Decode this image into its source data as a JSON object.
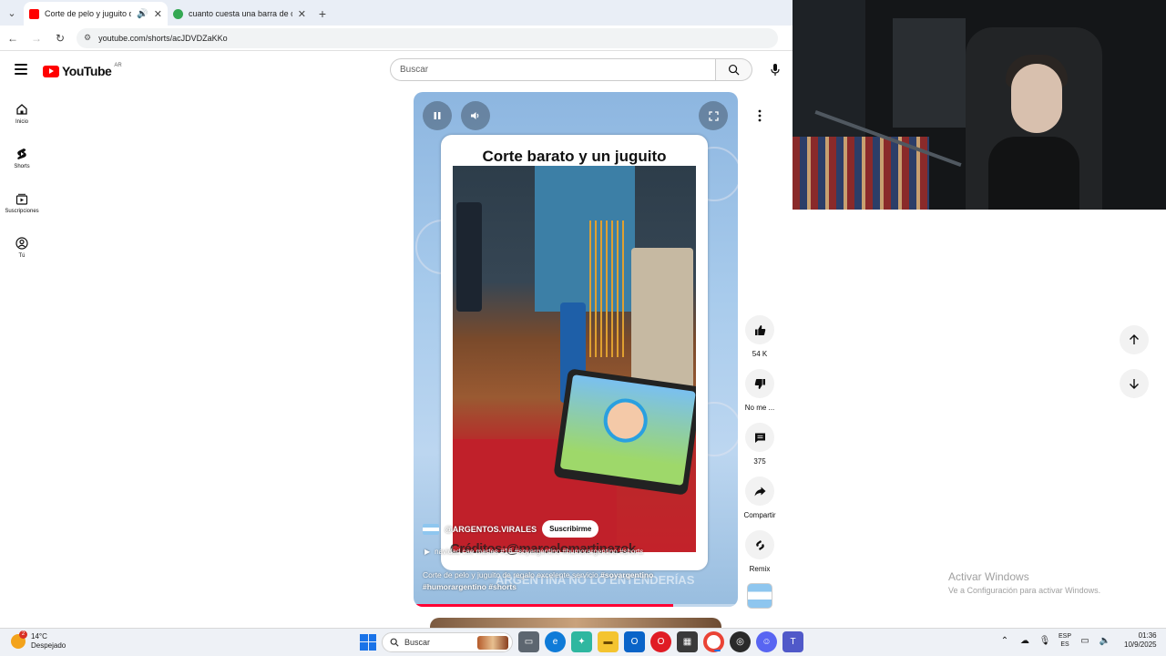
{
  "browser": {
    "tabs": [
      {
        "title": "Corte de pelo y juguito de r",
        "active": true,
        "favicon_color": "#ff0000"
      },
      {
        "title": "cuanto cuesta una barra de ch",
        "active": false,
        "favicon_color": "#34a853"
      }
    ],
    "url": "youtube.com/shorts/acJDVDZaKKo"
  },
  "youtube": {
    "logo_text": "YouTube",
    "country_code": "AR",
    "search_placeholder": "Buscar",
    "guide": [
      {
        "label": "Inicio",
        "icon": "home-icon"
      },
      {
        "label": "Shorts",
        "icon": "shorts-icon"
      },
      {
        "label": "Suscripciones",
        "icon": "subscriptions-icon"
      },
      {
        "label": "Tú",
        "icon": "you-icon"
      }
    ],
    "short": {
      "card_title": "Corte barato y un juguito",
      "channel": "@ARGENTOS.VIRALES",
      "subscribe_label": "Suscribirme",
      "music": "navidad cae martes #16 #soyargentino #humorargentino #shorts",
      "description": "Corte de pelo y juguito de regalo excelente servicio",
      "hashtags": "#soyargentino #humorargentino #shorts",
      "credit_text": "Créditos:@marcelomartinezok",
      "watermark_text": "ARGENTINA NO LO ENTENDERÍAS",
      "progress": 0.8
    },
    "actions": [
      {
        "label": "54 K",
        "icon": "like-icon"
      },
      {
        "label": "No me ...",
        "icon": "dislike-icon"
      },
      {
        "label": "375",
        "icon": "comment-icon"
      },
      {
        "label": "Compartir",
        "icon": "share-icon"
      },
      {
        "label": "Remix",
        "icon": "remix-icon"
      }
    ]
  },
  "windows": {
    "activate_title": "Activar Windows",
    "activate_subtitle": "Ve a Configuración para activar Windows."
  },
  "taskbar": {
    "weather_temp": "14°C",
    "weather_desc": "Despejado",
    "weather_badge": "2",
    "search_label": "Buscar",
    "lang_line1": "ESP",
    "lang_line2": "ES",
    "time": "01:36",
    "date": "10/9/2025"
  }
}
